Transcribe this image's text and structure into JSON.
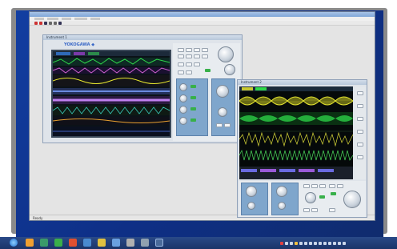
{
  "app": {
    "window_title": "",
    "status_text": "Ready"
  },
  "scope1": {
    "title": "Instrument 1",
    "brand": "YOKOGAWA ◆"
  },
  "scope2": {
    "title": "Instrument 2"
  },
  "taskbar": {
    "clock_time": "",
    "clock_date": ""
  },
  "colors": {
    "desktop": "#1240a0",
    "trace_yellow": "#e8e830",
    "trace_green": "#2ed84a",
    "trace_purple": "#9a5ad8",
    "panel_blue": "#7fa6cc"
  }
}
